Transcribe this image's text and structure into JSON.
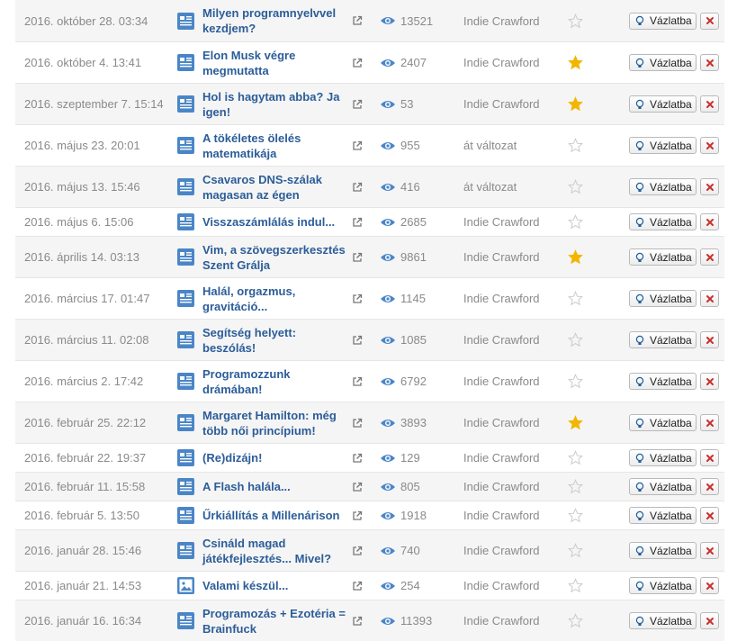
{
  "colors": {
    "title_link": "#2c5d99",
    "meta_text": "#8a8a8a",
    "star_active": "#f2b600",
    "star_inactive": "#c8c8c8",
    "delete_red": "#c9302c",
    "post_icon_blue": "#4a86c7"
  },
  "labels": {
    "draft_button": "Vázlatba"
  },
  "posts": [
    {
      "date": "2016. október 28. 03:34",
      "title": "Milyen programnyelvvel kezdjem?",
      "views": "13521",
      "author": "Indie Crawford",
      "starred": false,
      "icon": "article-icon",
      "lines": 2
    },
    {
      "date": "2016. október 4. 13:41",
      "title": "Elon Musk végre megmutatta",
      "views": "2407",
      "author": "Indie Crawford",
      "starred": true,
      "icon": "article-icon",
      "lines": 2
    },
    {
      "date": "2016. szeptember 7. 15:14",
      "title": "Hol is hagytam abba? Ja igen!",
      "views": "53",
      "author": "Indie Crawford",
      "starred": true,
      "icon": "article-icon",
      "lines": 2
    },
    {
      "date": "2016. május 23. 20:01",
      "title": "A tökéletes ölelés matematikája",
      "views": "955",
      "author": "át változat",
      "starred": false,
      "icon": "article-icon",
      "lines": 2
    },
    {
      "date": "2016. május 13. 15:46",
      "title": "Csavaros DNS-szálak magasan az égen",
      "views": "416",
      "author": "át változat",
      "starred": false,
      "icon": "article-icon",
      "lines": 2
    },
    {
      "date": "2016. május 6. 15:06",
      "title": "Visszaszámlálás indul...",
      "views": "2685",
      "author": "Indie Crawford",
      "starred": false,
      "icon": "article-icon",
      "lines": 1
    },
    {
      "date": "2016. április 14. 03:13",
      "title": "Vim, a szövegszerkesztés Szent Grálja",
      "views": "9861",
      "author": "Indie Crawford",
      "starred": true,
      "icon": "article-icon",
      "lines": 2
    },
    {
      "date": "2016. március 17. 01:47",
      "title": "Halál, orgazmus, gravitáció...",
      "views": "1145",
      "author": "Indie Crawford",
      "starred": false,
      "icon": "article-icon",
      "lines": 2
    },
    {
      "date": "2016. március 11. 02:08",
      "title": "Segítség helyett: beszólás!",
      "views": "1085",
      "author": "Indie Crawford",
      "starred": false,
      "icon": "article-icon",
      "lines": 2
    },
    {
      "date": "2016. március 2. 17:42",
      "title": "Programozzunk drámában!",
      "views": "6792",
      "author": "Indie Crawford",
      "starred": false,
      "icon": "article-icon",
      "lines": 2
    },
    {
      "date": "2016. február 25. 22:12",
      "title": "Margaret Hamilton: még több női princípium!",
      "views": "3893",
      "author": "Indie Crawford",
      "starred": true,
      "icon": "article-icon",
      "lines": 2
    },
    {
      "date": "2016. február 22. 19:37",
      "title": "(Re)dizájn!",
      "views": "129",
      "author": "Indie Crawford",
      "starred": false,
      "icon": "article-icon",
      "lines": 1
    },
    {
      "date": "2016. február 11. 15:58",
      "title": "A Flash halála...",
      "views": "805",
      "author": "Indie Crawford",
      "starred": false,
      "icon": "article-icon",
      "lines": 1
    },
    {
      "date": "2016. február 5. 13:50",
      "title": "Űrkiállítás a Millenárison",
      "views": "1918",
      "author": "Indie Crawford",
      "starred": false,
      "icon": "article-icon",
      "lines": 1
    },
    {
      "date": "2016. január 28. 15:46",
      "title": "Csináld magad játékfejlesztés... Mivel?",
      "views": "740",
      "author": "Indie Crawford",
      "starred": false,
      "icon": "article-icon",
      "lines": 2
    },
    {
      "date": "2016. január 21. 14:53",
      "title": "Valami készül...",
      "views": "254",
      "author": "Indie Crawford",
      "starred": false,
      "icon": "image-post-icon",
      "lines": 1
    },
    {
      "date": "2016. január 16. 16:34",
      "title": "Programozás + Ezotéria = Brainfuck",
      "views": "11393",
      "author": "Indie Crawford",
      "starred": false,
      "icon": "article-icon",
      "lines": 2
    }
  ]
}
